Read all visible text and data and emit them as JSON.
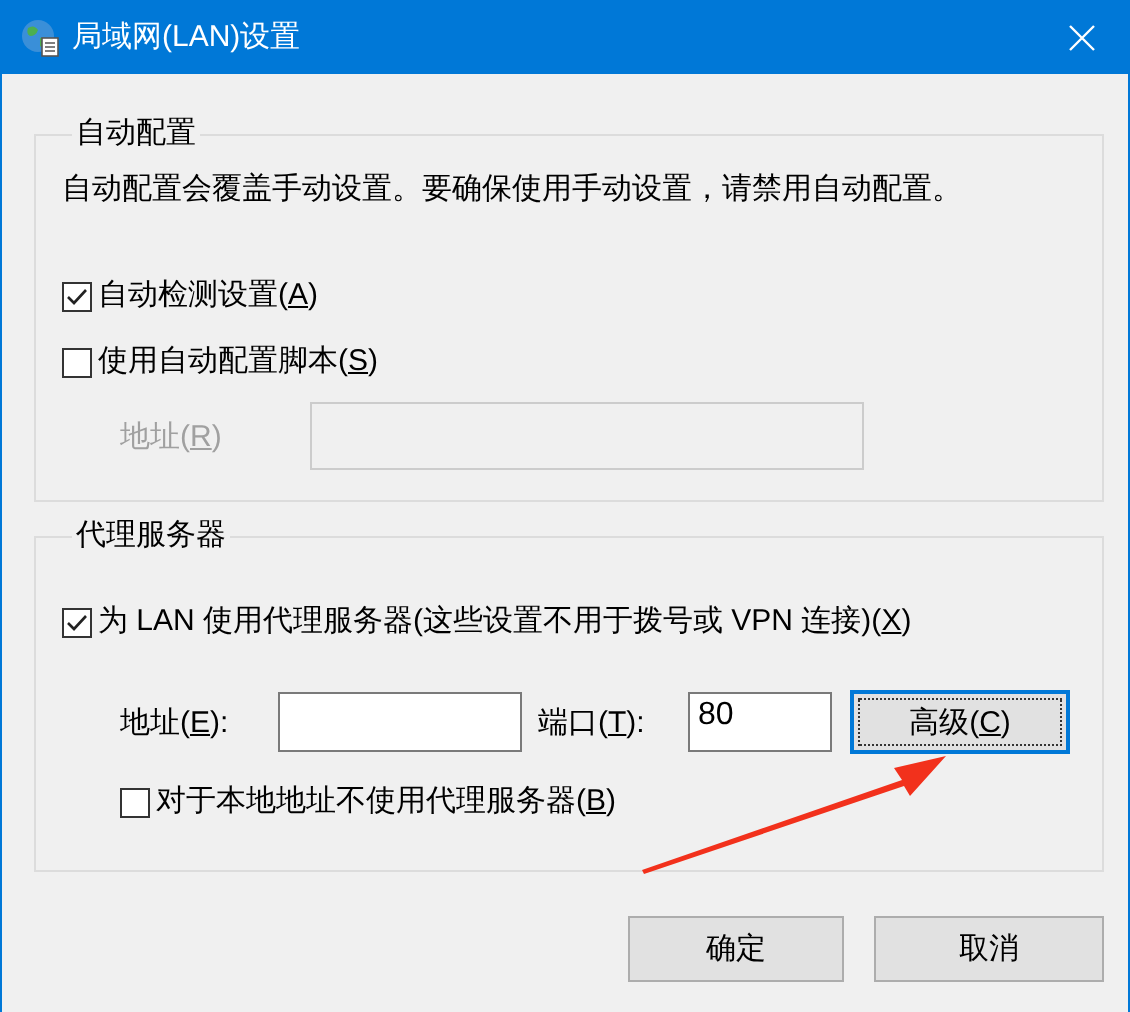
{
  "window": {
    "title": "局域网(LAN)设置"
  },
  "auto_config": {
    "title": "自动配置",
    "description": "自动配置会覆盖手动设置。要确保使用手动设置，请禁用自动配置。",
    "options": [
      {
        "label": [
          "自动检测设置(",
          "A",
          ")"
        ],
        "checked": true
      },
      {
        "label": [
          "使用自动配置脚本(",
          "S",
          ")"
        ],
        "checked": false
      }
    ],
    "address": {
      "label": [
        "地址(",
        "R",
        ")"
      ],
      "disabled": true
    }
  },
  "proxy": {
    "title": "代理服务器",
    "use_proxy": {
      "label": [
        "为 LAN 使用代理服务器(这些设置不用于拨号或 VPN 连接)(",
        "X",
        ")"
      ],
      "checked": true
    },
    "address": {
      "label": [
        "地址(",
        "E",
        "):"
      ]
    },
    "port": {
      "label": [
        "端口(",
        "T",
        "):"
      ],
      "value": "80"
    },
    "advanced_button": {
      "label": [
        "高级(",
        "C",
        ")"
      ],
      "focused": true
    },
    "bypass_local": {
      "label": [
        "对于本地地址不使用代理服务器(",
        "B",
        ")"
      ],
      "checked": false
    }
  },
  "buttons": [
    {
      "label": "确定"
    },
    {
      "label": "取消"
    }
  ]
}
